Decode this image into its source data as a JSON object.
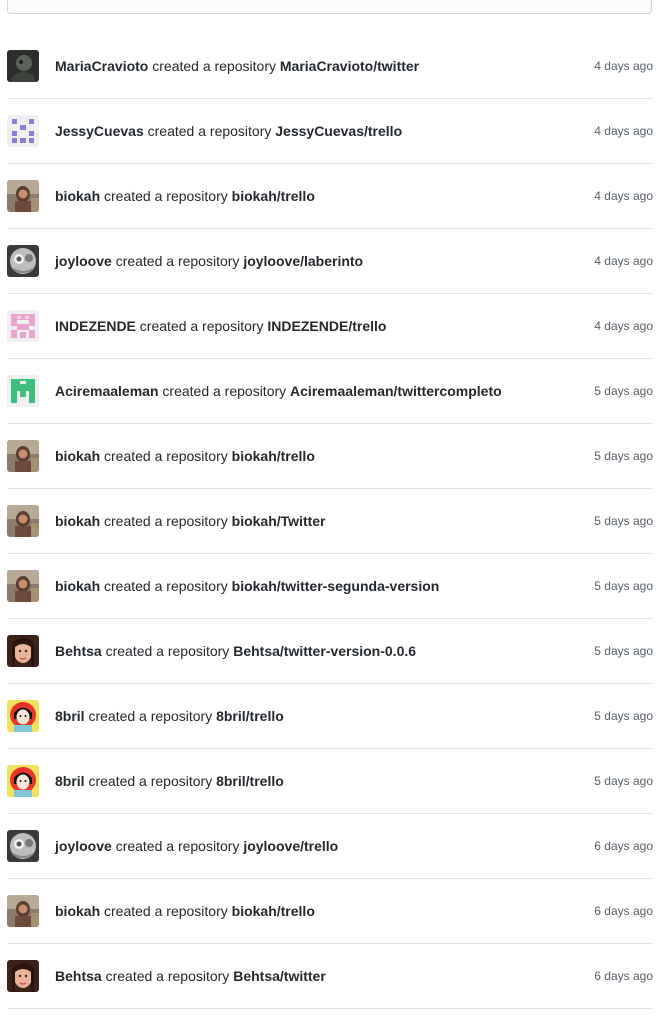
{
  "feed": {
    "items": [
      {
        "user": "MariaCravioto",
        "action": "created a repository",
        "repo": "MariaCravioto/twitter",
        "time": "4 days ago",
        "avatar": "photo-dark"
      },
      {
        "user": "JessyCuevas",
        "action": "created a repository",
        "repo": "JessyCuevas/trello",
        "time": "4 days ago",
        "avatar": "identicon-purple"
      },
      {
        "user": "biokah",
        "action": "created a repository",
        "repo": "biokah/trello",
        "time": "4 days ago",
        "avatar": "photo-biokah"
      },
      {
        "user": "joyloove",
        "action": "created a repository",
        "repo": "joyloove/laberinto",
        "time": "4 days ago",
        "avatar": "photo-joyloove"
      },
      {
        "user": "INDEZENDE",
        "action": "created a repository",
        "repo": "INDEZENDE/trello",
        "time": "4 days ago",
        "avatar": "identicon-pink"
      },
      {
        "user": "Aciremaaleman",
        "action": "created a repository",
        "repo": "Aciremaaleman/twittercompleto",
        "time": "5 days ago",
        "avatar": "identicon-green"
      },
      {
        "user": "biokah",
        "action": "created a repository",
        "repo": "biokah/trello",
        "time": "5 days ago",
        "avatar": "photo-biokah"
      },
      {
        "user": "biokah",
        "action": "created a repository",
        "repo": "biokah/Twitter",
        "time": "5 days ago",
        "avatar": "photo-biokah"
      },
      {
        "user": "biokah",
        "action": "created a repository",
        "repo": "biokah/twitter-segunda-version",
        "time": "5 days ago",
        "avatar": "photo-biokah"
      },
      {
        "user": "Behtsa",
        "action": "created a repository",
        "repo": "Behtsa/twitter-version-0.0.6",
        "time": "5 days ago",
        "avatar": "photo-behtsa"
      },
      {
        "user": "8bril",
        "action": "created a repository",
        "repo": "8bril/trello",
        "time": "5 days ago",
        "avatar": "cartoon-8bril"
      },
      {
        "user": "8bril",
        "action": "created a repository",
        "repo": "8bril/trello",
        "time": "5 days ago",
        "avatar": "cartoon-8bril"
      },
      {
        "user": "joyloove",
        "action": "created a repository",
        "repo": "joyloove/trello",
        "time": "6 days ago",
        "avatar": "photo-joyloove"
      },
      {
        "user": "biokah",
        "action": "created a repository",
        "repo": "biokah/trello",
        "time": "6 days ago",
        "avatar": "photo-biokah"
      },
      {
        "user": "Behtsa",
        "action": "created a repository",
        "repo": "Behtsa/twitter",
        "time": "6 days ago",
        "avatar": "photo-behtsa"
      }
    ]
  },
  "colors": {
    "text": "#24292e",
    "muted": "#586069",
    "border": "#e1e4e8",
    "identicon_purple": "#8f7bd6",
    "identicon_pink": "#eba3cf",
    "identicon_green": "#3fbf7f"
  }
}
